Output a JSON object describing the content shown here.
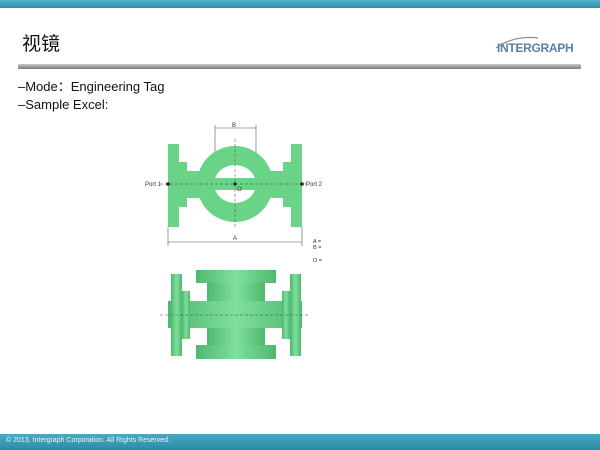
{
  "slide": {
    "title": "视镜",
    "logo_text": "INTERGRAPH",
    "bullets": [
      "–Mode：Engineering Tag",
      "–Sample Excel:"
    ],
    "footer": "© 2013, Intergraph Corporation. All Rights Reserved."
  },
  "figure": {
    "dim_b": "B",
    "dim_a": "A",
    "center_label": "O",
    "port1": "Port 1",
    "port2": "Port 2",
    "legend": [
      "A =",
      "B =",
      "O ="
    ]
  },
  "colors": {
    "accent": "#3a9fbd",
    "body_green": "#69d388",
    "edge_green": "#4fb86e"
  }
}
